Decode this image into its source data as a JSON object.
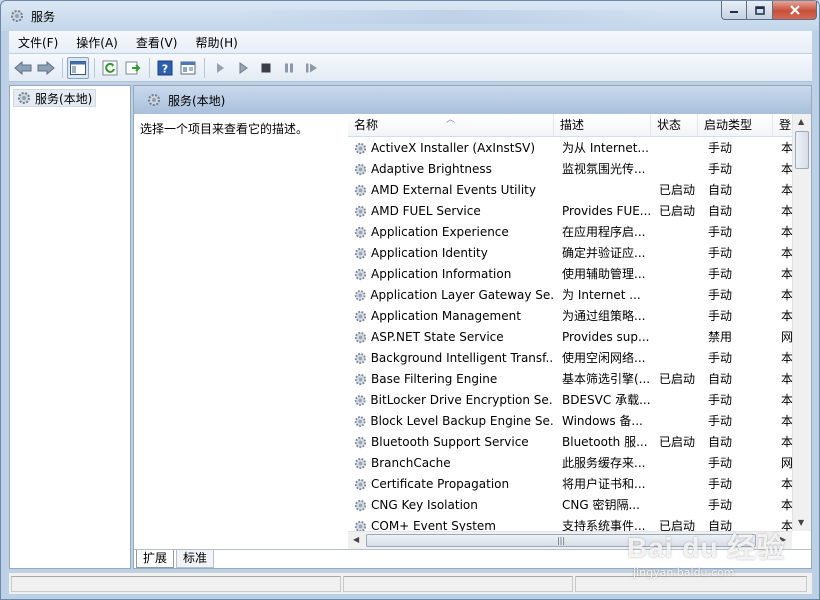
{
  "window": {
    "title": "服务"
  },
  "menu": [
    "文件(F)",
    "操作(A)",
    "查看(V)",
    "帮助(H)"
  ],
  "tree": {
    "root": "服务(本地)"
  },
  "panel": {
    "title": "服务(本地)",
    "description_hint": "选择一个项目来查看它的描述。"
  },
  "columns": [
    "名称",
    "描述",
    "状态",
    "启动类型",
    "登"
  ],
  "services": [
    {
      "name": "ActiveX Installer (AxInstSV)",
      "desc": "为从 Internet...",
      "status": "",
      "startup": "手动",
      "logon": "本"
    },
    {
      "name": "Adaptive Brightness",
      "desc": "监视氛围光传...",
      "status": "",
      "startup": "手动",
      "logon": "本"
    },
    {
      "name": "AMD External Events Utility",
      "desc": "",
      "status": "已启动",
      "startup": "自动",
      "logon": "本"
    },
    {
      "name": "AMD FUEL Service",
      "desc": "Provides FUE...",
      "status": "已启动",
      "startup": "自动",
      "logon": "本"
    },
    {
      "name": "Application Experience",
      "desc": "在应用程序启...",
      "status": "",
      "startup": "手动",
      "logon": "本"
    },
    {
      "name": "Application Identity",
      "desc": "确定并验证应...",
      "status": "",
      "startup": "手动",
      "logon": "本"
    },
    {
      "name": "Application Information",
      "desc": "使用辅助管理...",
      "status": "",
      "startup": "手动",
      "logon": "本"
    },
    {
      "name": "Application Layer Gateway Se...",
      "desc": "为 Internet ...",
      "status": "",
      "startup": "手动",
      "logon": "本"
    },
    {
      "name": "Application Management",
      "desc": "为通过组策略...",
      "status": "",
      "startup": "手动",
      "logon": "本"
    },
    {
      "name": "ASP.NET State Service",
      "desc": "Provides sup...",
      "status": "",
      "startup": "禁用",
      "logon": "网"
    },
    {
      "name": "Background Intelligent Transf...",
      "desc": "使用空闲网络...",
      "status": "",
      "startup": "手动",
      "logon": "本"
    },
    {
      "name": "Base Filtering Engine",
      "desc": "基本筛选引擎(...",
      "status": "已启动",
      "startup": "自动",
      "logon": "本"
    },
    {
      "name": "BitLocker Drive Encryption Se...",
      "desc": "BDESVC 承载...",
      "status": "",
      "startup": "手动",
      "logon": "本"
    },
    {
      "name": "Block Level Backup Engine Se...",
      "desc": "Windows 备...",
      "status": "",
      "startup": "手动",
      "logon": "本"
    },
    {
      "name": "Bluetooth Support Service",
      "desc": "Bluetooth 服...",
      "status": "已启动",
      "startup": "自动",
      "logon": "本"
    },
    {
      "name": "BranchCache",
      "desc": "此服务缓存来...",
      "status": "",
      "startup": "手动",
      "logon": "网"
    },
    {
      "name": "Certificate Propagation",
      "desc": "将用户证书和...",
      "status": "",
      "startup": "手动",
      "logon": "本"
    },
    {
      "name": "CNG Key Isolation",
      "desc": "CNG 密钥隔...",
      "status": "",
      "startup": "手动",
      "logon": "本"
    },
    {
      "name": "COM+ Event System",
      "desc": "支持系统事件...",
      "status": "已启动",
      "startup": "自动",
      "logon": "本"
    }
  ],
  "tabs": [
    "扩展",
    "标准"
  ],
  "watermark": {
    "logo": "Bai du 经验",
    "url": "jingyan.baidu.com"
  }
}
